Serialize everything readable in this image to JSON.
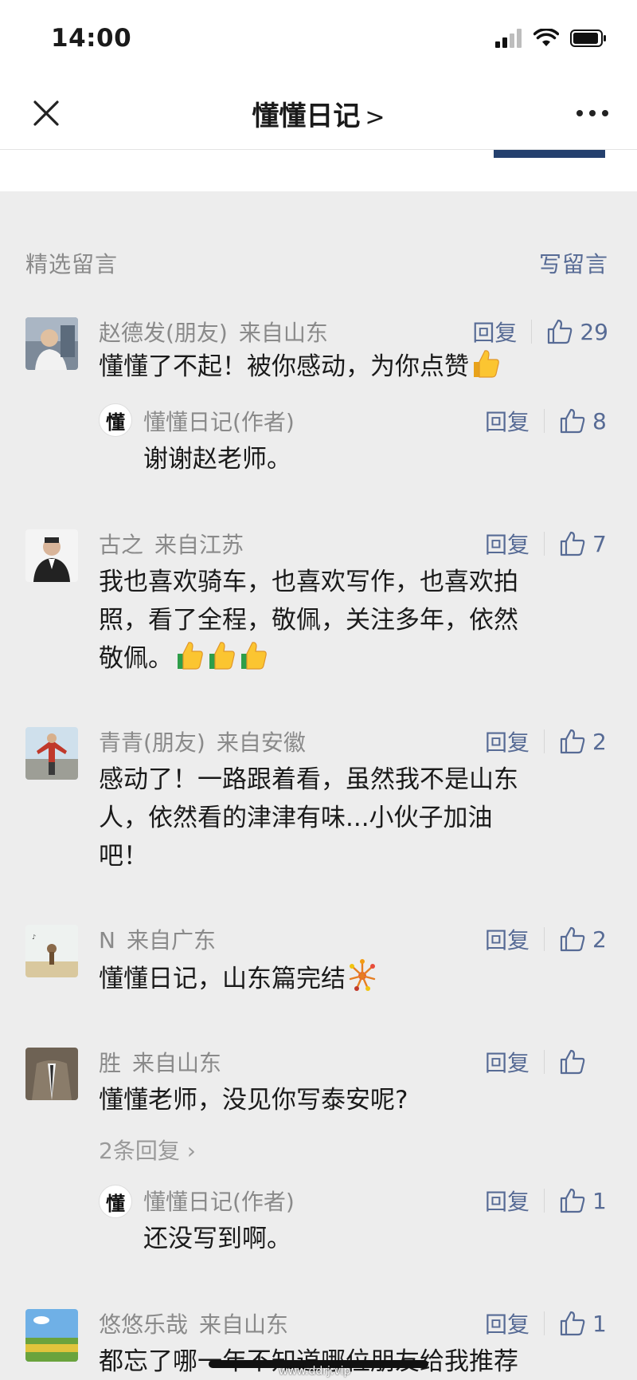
{
  "status_bar": {
    "time": "14:00"
  },
  "nav": {
    "title": "懂懂日记",
    "title_chevron": ">"
  },
  "section": {
    "title": "精选留言",
    "write_label": "写留言"
  },
  "comments": [
    {
      "name": "赵德发(朋友)",
      "location": "来自山东",
      "reply_label": "回复",
      "likes": "29",
      "text": "懂懂了不起！被你感动，为你点赞",
      "author_reply": {
        "name": "懂懂日记(作者)",
        "avatar_char": "懂",
        "reply_label": "回复",
        "likes": "8",
        "text": "谢谢赵老师。"
      }
    },
    {
      "name": "古之",
      "location": "来自江苏",
      "reply_label": "回复",
      "likes": "7",
      "text_lines": [
        "我也喜欢骑车，也喜欢写作，也喜欢拍",
        "照，看了全程，敬佩，关注多年，依然",
        "敬佩。"
      ]
    },
    {
      "name": "青青(朋友)",
      "location": "来自安徽",
      "reply_label": "回复",
      "likes": "2",
      "text_lines": [
        "感动了！一路跟着看，虽然我不是山东",
        "人，依然看的津津有味...小伙子加油",
        "吧！"
      ]
    },
    {
      "name": "N",
      "location": "来自广东",
      "reply_label": "回复",
      "likes": "2",
      "text": "懂懂日记，山东篇完结"
    },
    {
      "name": "胜",
      "location": "来自山东",
      "reply_label": "回复",
      "likes": "",
      "text": "懂懂老师，没见你写泰安呢?",
      "more_replies": "2条回复",
      "author_reply": {
        "name": "懂懂日记(作者)",
        "avatar_char": "懂",
        "reply_label": "回复",
        "likes": "1",
        "text": "还没写到啊。"
      }
    },
    {
      "name": "悠悠乐哉",
      "location": "来自山东",
      "reply_label": "回复",
      "likes": "1",
      "text": "都忘了哪一年不知道哪位朋友给我推荐"
    }
  ],
  "watermark": "www.ddrj.vip",
  "colors": {
    "link": "#576b95",
    "meta": "#8a8a8a",
    "background": "#ededed"
  }
}
